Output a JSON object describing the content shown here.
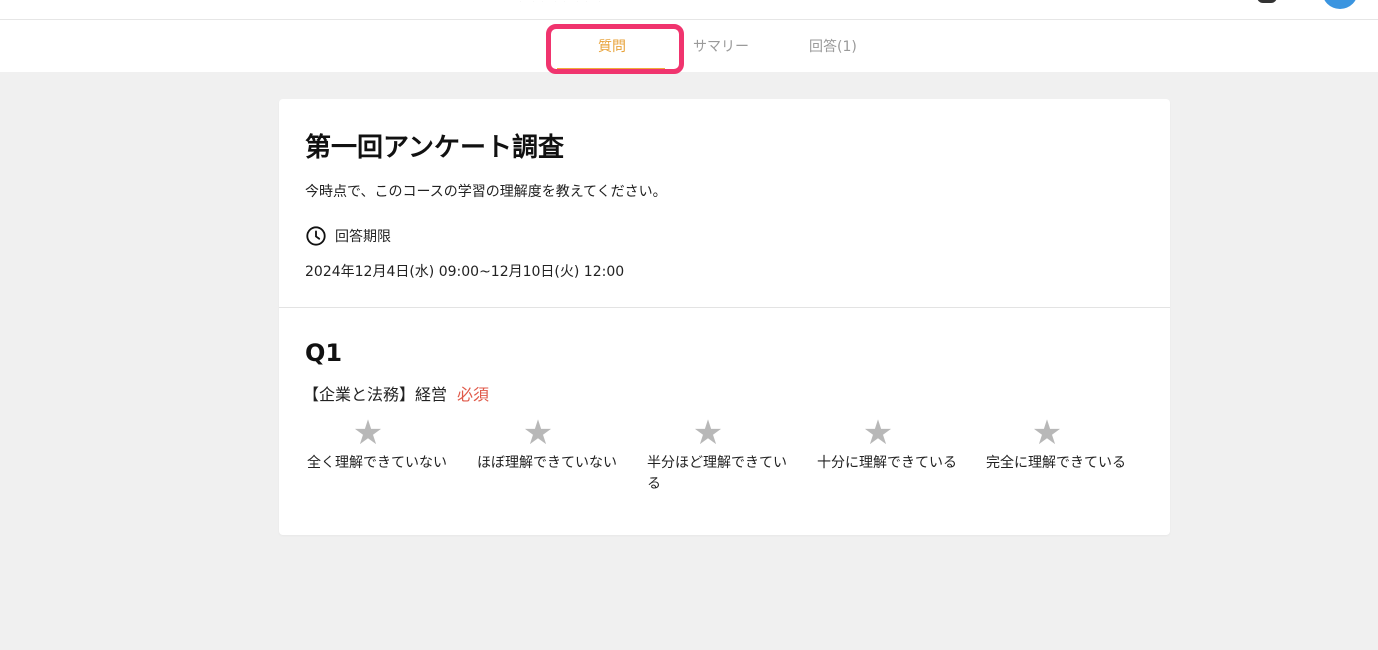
{
  "tabs": [
    {
      "label": "質問",
      "active": true
    },
    {
      "label": "サマリー",
      "active": false
    },
    {
      "label": "回答(1)",
      "active": false
    }
  ],
  "survey": {
    "title": "第一回アンケート調査",
    "description": "今時点で、このコースの学習の理解度を教えてください。",
    "deadline_label": "回答期限",
    "deadline_value": "2024年12月4日(水) 09:00~12月10日(火) 12:00"
  },
  "question": {
    "number": "Q1",
    "text": "【企業と法務】経営",
    "required_label": "必須",
    "options": [
      {
        "label": "全く理解できていない"
      },
      {
        "label": "ほぼ理解できていない"
      },
      {
        "label": "半分ほど理解できている"
      },
      {
        "label": "十分に理解できている"
      },
      {
        "label": "完全に理解できている"
      }
    ]
  },
  "colors": {
    "accent": "#e8a33b",
    "highlight": "#f0346e",
    "required": "#e05a4a",
    "star": "#b8b8b8",
    "background": "#f0f0f0"
  },
  "icons": {
    "deadline": "clock-icon",
    "rating": "star-icon"
  }
}
